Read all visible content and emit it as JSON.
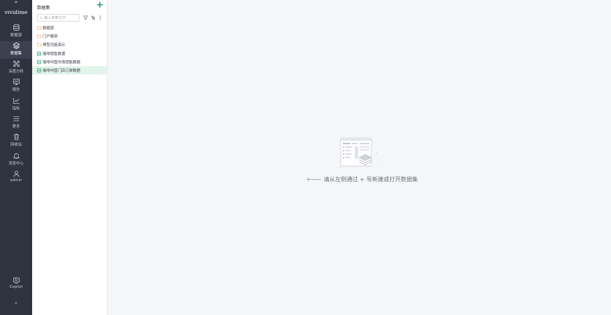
{
  "brand": "vividime",
  "nav": {
    "items": [
      {
        "label": "数据源",
        "icon": "database-icon"
      },
      {
        "label": "数据集",
        "icon": "layers-icon",
        "active": true
      },
      {
        "label": "深度分析",
        "icon": "analysis-icon"
      },
      {
        "label": "报告",
        "icon": "report-icon"
      },
      {
        "label": "指标",
        "icon": "metric-icon"
      },
      {
        "label": "更多",
        "icon": "menu-icon"
      },
      {
        "label": "回收站",
        "icon": "trash-icon"
      },
      {
        "label": "消息中心",
        "icon": "bell-icon"
      },
      {
        "label": "admin",
        "icon": "user-icon"
      }
    ],
    "copilot": {
      "label": "Copilot",
      "icon": "copilot-icon"
    },
    "collapse_glyph": "«"
  },
  "panel": {
    "title": "数据集",
    "add_label": "+",
    "search_placeholder": "输入搜索文字",
    "tree": [
      {
        "label": "数据源",
        "kind": "folder"
      },
      {
        "label": "门户案例",
        "kind": "folder"
      },
      {
        "label": "典型功能演示",
        "kind": "folder"
      },
      {
        "label": "咖啡销售数据",
        "kind": "dataset"
      },
      {
        "label": "咖啡中国市场销售数据",
        "kind": "dataset"
      },
      {
        "label": "咖啡中国门店订单数据",
        "kind": "dataset",
        "selected": true
      }
    ]
  },
  "main": {
    "empty_hint": "请从左侧通过 + 号新建或打开数据集",
    "empty_arrow": "🡐"
  },
  "colors": {
    "rail": "#2f3340",
    "accent": "#1aa36a",
    "folder": "#e8a33d",
    "selected_row": "#e3f4ea"
  }
}
